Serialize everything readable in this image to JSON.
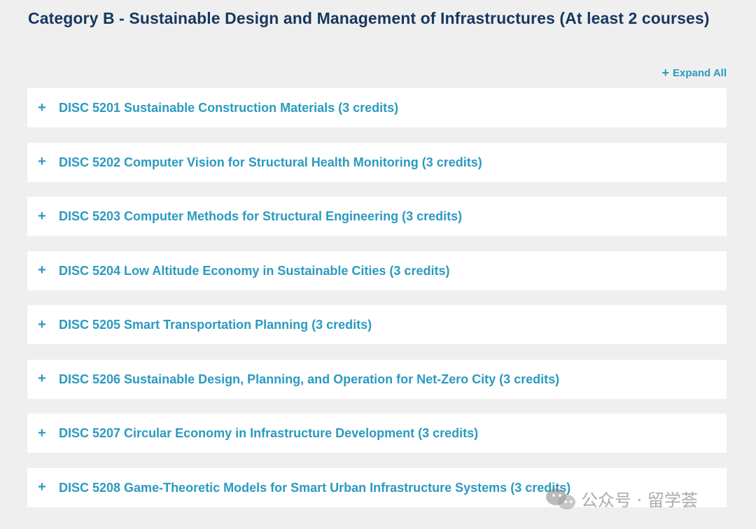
{
  "section": {
    "title": "Category B - Sustainable Design and Management of Infrastructures (At least 2 courses)"
  },
  "controls": {
    "expand_icon": "plus-icon",
    "expand_symbol": "+",
    "expand_all_label": "Expand All"
  },
  "courses": [
    {
      "symbol": "+",
      "label": "DISC 5201 Sustainable Construction Materials (3 credits)"
    },
    {
      "symbol": "+",
      "label": "DISC 5202 Computer Vision for Structural Health Monitoring (3 credits)"
    },
    {
      "symbol": "+",
      "label": "DISC 5203 Computer Methods for Structural Engineering (3 credits)"
    },
    {
      "symbol": "+",
      "label": "DISC 5204 Low Altitude Economy in Sustainable Cities (3 credits)"
    },
    {
      "symbol": "+",
      "label": "DISC 5205 Smart Transportation Planning (3 credits)"
    },
    {
      "symbol": "+",
      "label": "DISC 5206 Sustainable Design, Planning, and Operation for Net-Zero City (3 credits)"
    },
    {
      "symbol": "+",
      "label": "DISC 5207 Circular Economy in Infrastructure Development (3 credits)"
    },
    {
      "symbol": "+",
      "label": "DISC 5208 Game-Theoretic Models for Smart Urban Infrastructure Systems (3 credits)"
    }
  ],
  "watermark": {
    "icon": "wechat-icon",
    "text": "公众号 · 留学荟"
  },
  "colors": {
    "background": "#efeff0",
    "heading": "#16375f",
    "accent": "#2b9ac0",
    "card": "#ffffff"
  }
}
